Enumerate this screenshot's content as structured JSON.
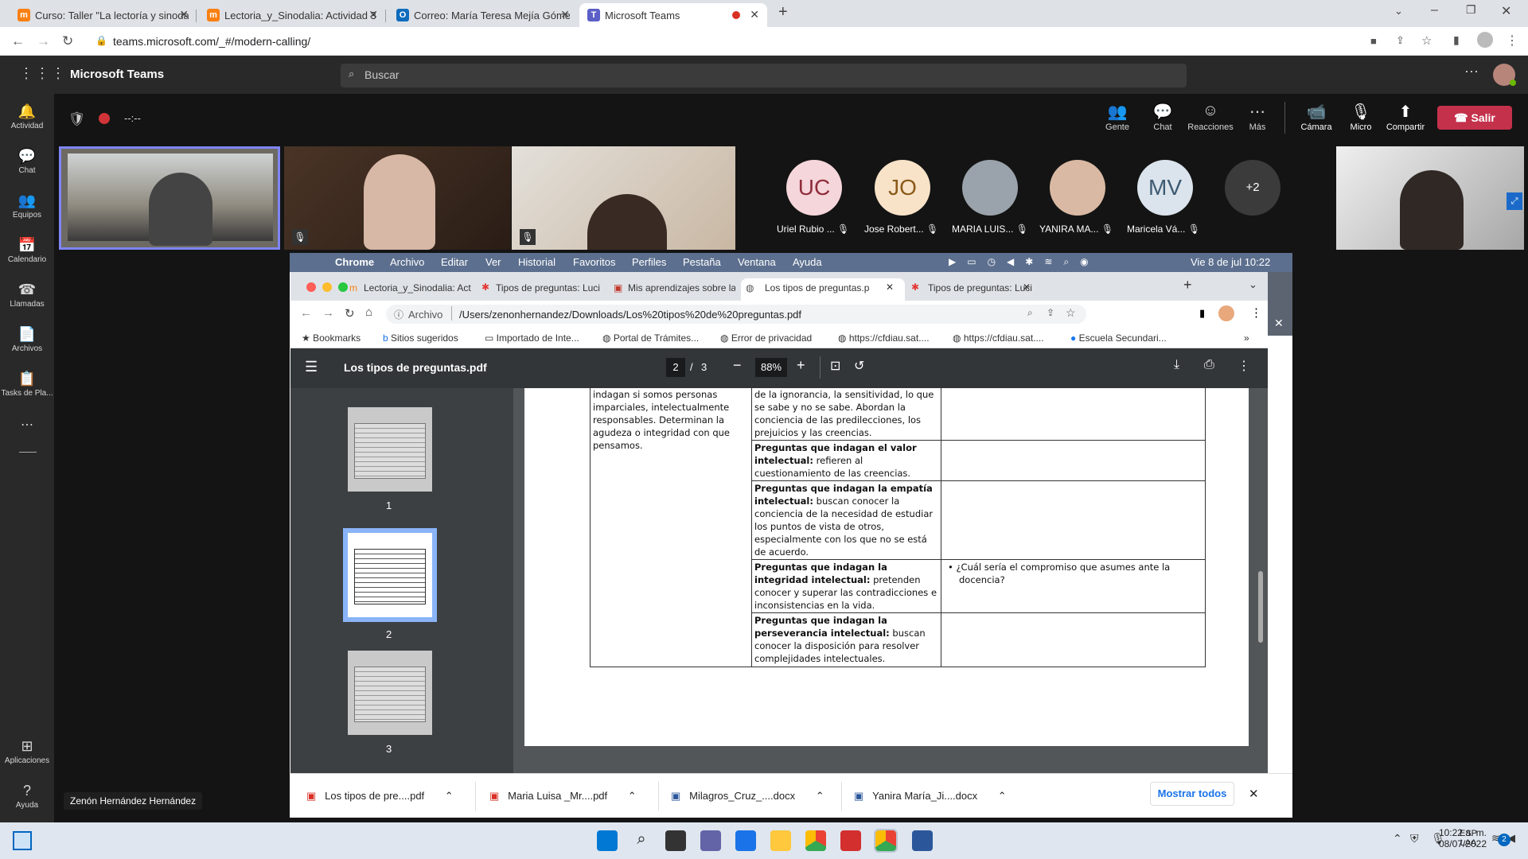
{
  "browser": {
    "tabs": [
      {
        "label": "Curso: Taller \"La lectoría y sinoda",
        "icon": "moodle-icon"
      },
      {
        "label": "Lectoria_y_Sinodalia: Actividad 3",
        "icon": "moodle-icon"
      },
      {
        "label": "Correo: María Teresa Mejía Góme",
        "icon": "outlook-icon"
      },
      {
        "label": "Microsoft Teams",
        "icon": "teams-icon"
      }
    ],
    "url": "teams.microsoft.com/_#/modern-calling/"
  },
  "teams": {
    "app_title": "Microsoft Teams",
    "search_placeholder": "Buscar",
    "timer": "--:--",
    "rail": [
      {
        "label": "Actividad",
        "icon": "bell-icon"
      },
      {
        "label": "Chat",
        "icon": "chat-icon"
      },
      {
        "label": "Equipos",
        "icon": "teams-group-icon"
      },
      {
        "label": "Calendario",
        "icon": "calendar-icon"
      },
      {
        "label": "Llamadas",
        "icon": "phone-icon"
      },
      {
        "label": "Archivos",
        "icon": "file-icon"
      },
      {
        "label": "Tasks de Pla...",
        "icon": "tasks-icon"
      },
      {
        "label": "Aplicaciones",
        "icon": "apps-icon"
      },
      {
        "label": "Ayuda",
        "icon": "help-icon"
      }
    ],
    "controls": [
      {
        "label": "Gente",
        "icon": "people-icon"
      },
      {
        "label": "Chat",
        "icon": "chat-icon"
      },
      {
        "label": "Reacciones",
        "icon": "reactions-icon"
      },
      {
        "label": "Más",
        "icon": "more-icon"
      },
      {
        "label": "Cámara",
        "icon": "camera-icon"
      },
      {
        "label": "Micro",
        "icon": "mic-off-icon"
      },
      {
        "label": "Compartir",
        "icon": "share-icon"
      }
    ],
    "leave_label": "Salir",
    "participants": [
      {
        "initials": "UC",
        "name": "Uriel Rubio ...",
        "color": "#f5d6da"
      },
      {
        "initials": "JO",
        "name": "Jose Robert...",
        "color": "#f8e3c9"
      },
      {
        "initials": "",
        "name": "MARIA LUIS...",
        "color": "#9aa3ab"
      },
      {
        "initials": "",
        "name": "YANIRA MA...",
        "color": "#d9b9a3"
      },
      {
        "initials": "MV",
        "name": "Maricela Vá...",
        "color": "#dbe4ec"
      }
    ],
    "overflow_count": "+2",
    "presenter_name": "Zenón Hernández Hernández"
  },
  "mac": {
    "menu": [
      "Chrome",
      "Archivo",
      "Editar",
      "Ver",
      "Historial",
      "Favoritos",
      "Perfiles",
      "Pestaña",
      "Ventana",
      "Ayuda"
    ],
    "clock": "Vie 8 de jul  10:22"
  },
  "inner_browser": {
    "tabs": [
      "Lectoria_y_Sinodalia: Act",
      "Tipos de preguntas: Luci",
      "Mis aprendizajes sobre la",
      "Los tipos de preguntas.p",
      "Tipos de preguntas: Luci"
    ],
    "address_prefix": "Archivo",
    "address": "/Users/zenonhernandez/Downloads/Los%20tipos%20de%20preguntas.pdf",
    "bookmarks": [
      "Bookmarks",
      "Sitios sugeridos",
      "Importado de Inte...",
      "Portal de Trámites...",
      "Error de privacidad",
      "https://cfdiau.sat....",
      "https://cfdiau.sat....",
      "Escuela Secundari..."
    ]
  },
  "pdf": {
    "filename": "Los tipos de preguntas.pdf",
    "current_page": "2",
    "total_pages": "3",
    "zoom": "88%",
    "thumbnails": [
      "1",
      "2",
      "3"
    ],
    "col1_text": "indagan si somos personas imparciales, intelectualmente responsables. Determinan la agudeza o integridad con que pensamos.",
    "rows": [
      {
        "bold": "",
        "text": "de la ignorancia, la sensitividad, lo que se sabe y no se sabe. Abordan la conciencia de las predilecciones, los prejuicios y las creencias.",
        "answer": ""
      },
      {
        "bold": "Preguntas que indagan el valor intelectual:",
        "text": " refieren al cuestionamiento de las creencias.",
        "answer": ""
      },
      {
        "bold": "Preguntas que indagan la empatía intelectual:",
        "text": " buscan conocer la conciencia de la necesidad de estudiar los puntos de vista de otros, especialmente con los que no se está de acuerdo.",
        "answer": ""
      },
      {
        "bold": "Preguntas que indagan la integridad intelectual:",
        "text": " pretenden conocer y superar las contradicciones e inconsistencias en la vida.",
        "answer": "¿Cuál sería el compromiso que asumes ante la docencia?"
      },
      {
        "bold": "Preguntas que indagan la perseverancia intelectual:",
        "text": " buscan conocer la disposición para resolver complejidades intelectuales.",
        "answer": ""
      }
    ]
  },
  "downloads": {
    "items": [
      "Los tipos de pre....pdf",
      "Maria Luisa _Mr....pdf",
      "Milagros_Cruz_....docx",
      "Yanira María_Ji....docx"
    ],
    "show_all": "Mostrar todos"
  },
  "taskbar": {
    "lang": "ESP",
    "lang2": "LAA",
    "time": "10:22 a. m.",
    "date": "08/07/2022",
    "notif": "2"
  }
}
